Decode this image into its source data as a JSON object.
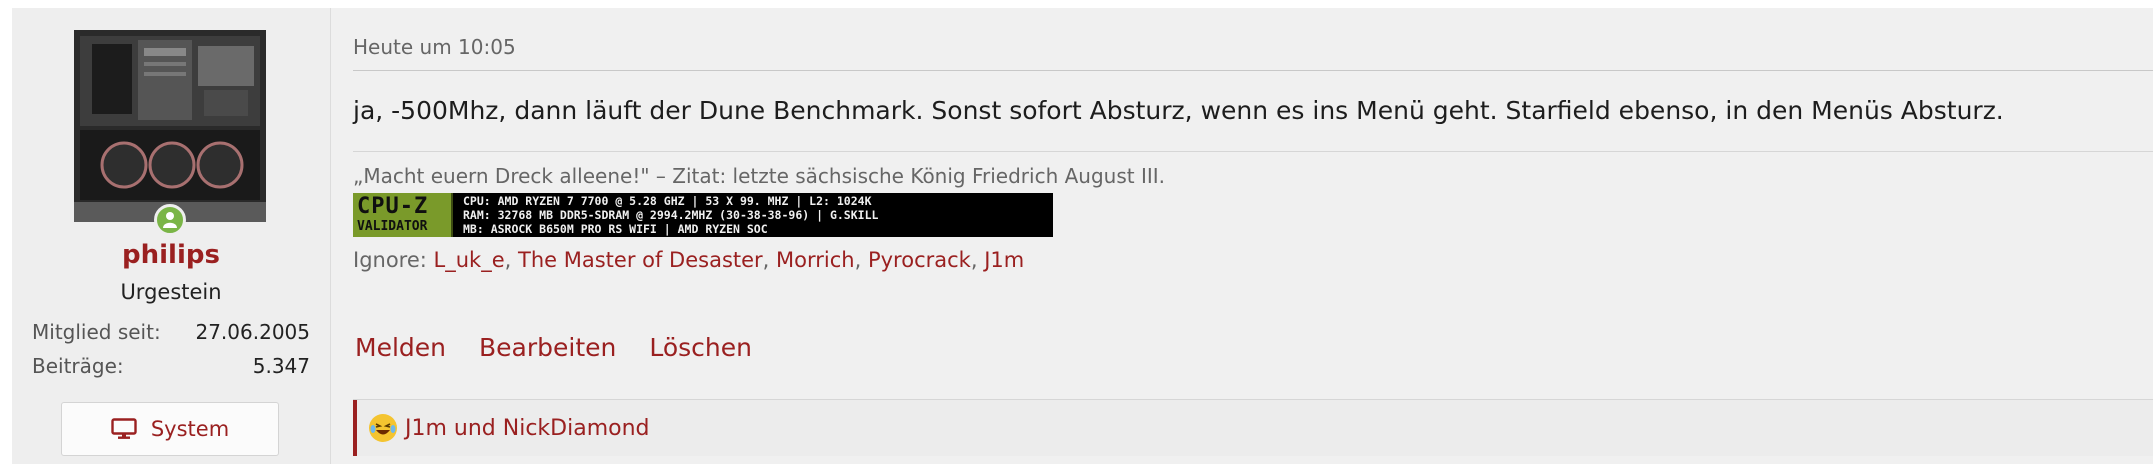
{
  "user": {
    "name": "philips",
    "title": "Urgestein",
    "stats": [
      {
        "label": "Mitglied seit:",
        "value": "27.06.2005"
      },
      {
        "label": "Beiträge:",
        "value": "5.347"
      }
    ],
    "system_button": "System",
    "online_icon": "user-online-icon",
    "system_icon": "monitor-icon"
  },
  "post": {
    "timestamp": "Heute um 10:05",
    "message": "ja, -500Mhz, dann läuft der Dune Benchmark. Sonst sofort Absturz, wenn es ins Menü geht. Starfield ebenso, in den Menüs Absturz.",
    "signature_quote": "„Macht euern Dreck alleene!\" – Zitat: letzte sächsische König Friedrich August III.",
    "cpuz": {
      "logo_top": "CPU-Z",
      "logo_bottom": "VALIDATOR",
      "line1": "CPU: AMD RYZEN 7 7700 @ 5.28 GHZ | 53 X 99. MHZ | L2: 1024K",
      "line2": "RAM: 32768 MB DDR5-SDRAM @ 2994.2MHZ (30-38-38-96) | G.SKILL",
      "line3": "MB: ASROCK B650M PRO RS WIFI | AMD RYZEN SOC"
    },
    "ignore_label": "Ignore:",
    "ignore_users": [
      "L_uk_e",
      "The Master of Desaster",
      "Morrich",
      "Pyrocrack",
      "J1m"
    ],
    "actions": {
      "report": "Melden",
      "edit": "Bearbeiten",
      "delete": "Löschen"
    },
    "reactions_text": "J1m und NickDiamond",
    "reaction_icon": "laughing-emoji-icon"
  },
  "colors": {
    "accent": "#9a2020",
    "online": "#7ab547",
    "background": "#f0f0f0"
  }
}
